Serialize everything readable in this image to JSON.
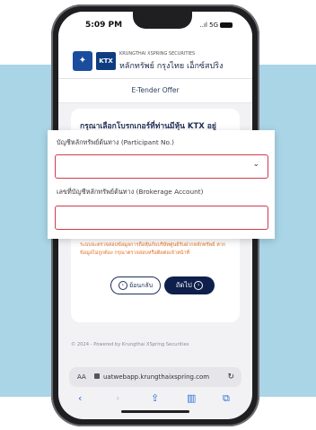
{
  "status_bar": {
    "time": "5:09 PM",
    "signal": "..ıl 5G"
  },
  "brand": {
    "logo_icon": "krungthai-logo-icon",
    "ktx_badge": "KTX",
    "name_en": "KRUNGTHAI XSPRING SECURITIES",
    "name_th": "หลักทรัพย์ กรุงไทย เอ็กซ์สปริง"
  },
  "page": {
    "subtitle": "E-Tender Offer"
  },
  "card": {
    "heading": "กรุณาเลือกโบรกเกอร์ที่ท่านมีหุ้น KTX อยู่",
    "warning": "ระบบจะตรวจสอบข้อมูลการถือหุ้นกับบริษัทศูนย์รับฝากหลักทรัพย์ หากข้อมูลไม่ถูกต้อง\nกรุณาตรวจสอบหรือติดต่อเจ้าหน้าที่",
    "back_label": "ย้อนกลับ",
    "back_icon": "arrow-left-circle-icon",
    "next_label": "ถัดไป",
    "next_icon": "arrow-right-circle-icon"
  },
  "overlay": {
    "participant_label": "บัญชีหลักทรัพย์ต้นทาง (Participant No.)",
    "participant_value": "",
    "brokerage_label": "เลขที่บัญชีหลักทรัพย์ต้นทาง (Brokerage Account)",
    "brokerage_value": ""
  },
  "footer": {
    "text": "© 2024 - Powered by Krungthai XSpring Securities"
  },
  "browser": {
    "aa_label": "AA",
    "url": "uatwebapp.krungthaixspring.com",
    "reload_icon": "reload-icon",
    "toolbar_icons": [
      "back-icon",
      "forward-icon",
      "share-icon",
      "bookmarks-icon",
      "tabs-icon"
    ]
  },
  "colors": {
    "accent": "#0e1f4b",
    "error_border": "#cf3b4a",
    "warning_text": "#e36f1e",
    "background_band": "#a9d5e6"
  }
}
